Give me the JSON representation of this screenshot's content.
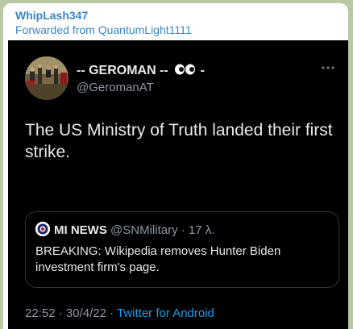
{
  "message": {
    "sender": "WhipLash347",
    "forwarded_prefix": "Forwarded from ",
    "forwarded_name": "QuantumLight1111"
  },
  "tweet": {
    "display_name": "-- GEROMAN --",
    "display_name_suffix": " -",
    "handle": "@GeromanAT",
    "text": "The US Ministry of Truth landed their first strike.",
    "quote": {
      "name": "MI NEWS",
      "handle": "@SNMilitary",
      "separator": " · ",
      "time": "17 λ.",
      "text": "BREAKING: Wikipedia removes Hunter Biden investment firm's page."
    },
    "time": "22:52",
    "date": "30/4/22",
    "meta_separator": " · ",
    "source": "Twitter for Android"
  },
  "icons": {
    "more": "more-horizontal-icon",
    "eyes": "eyes-emoji-icon"
  },
  "colors": {
    "chat_background": "#b8c9a6",
    "link_blue": "#3a86c8",
    "twitter_blue": "#1d9bf0",
    "tweet_background": "#000000"
  }
}
